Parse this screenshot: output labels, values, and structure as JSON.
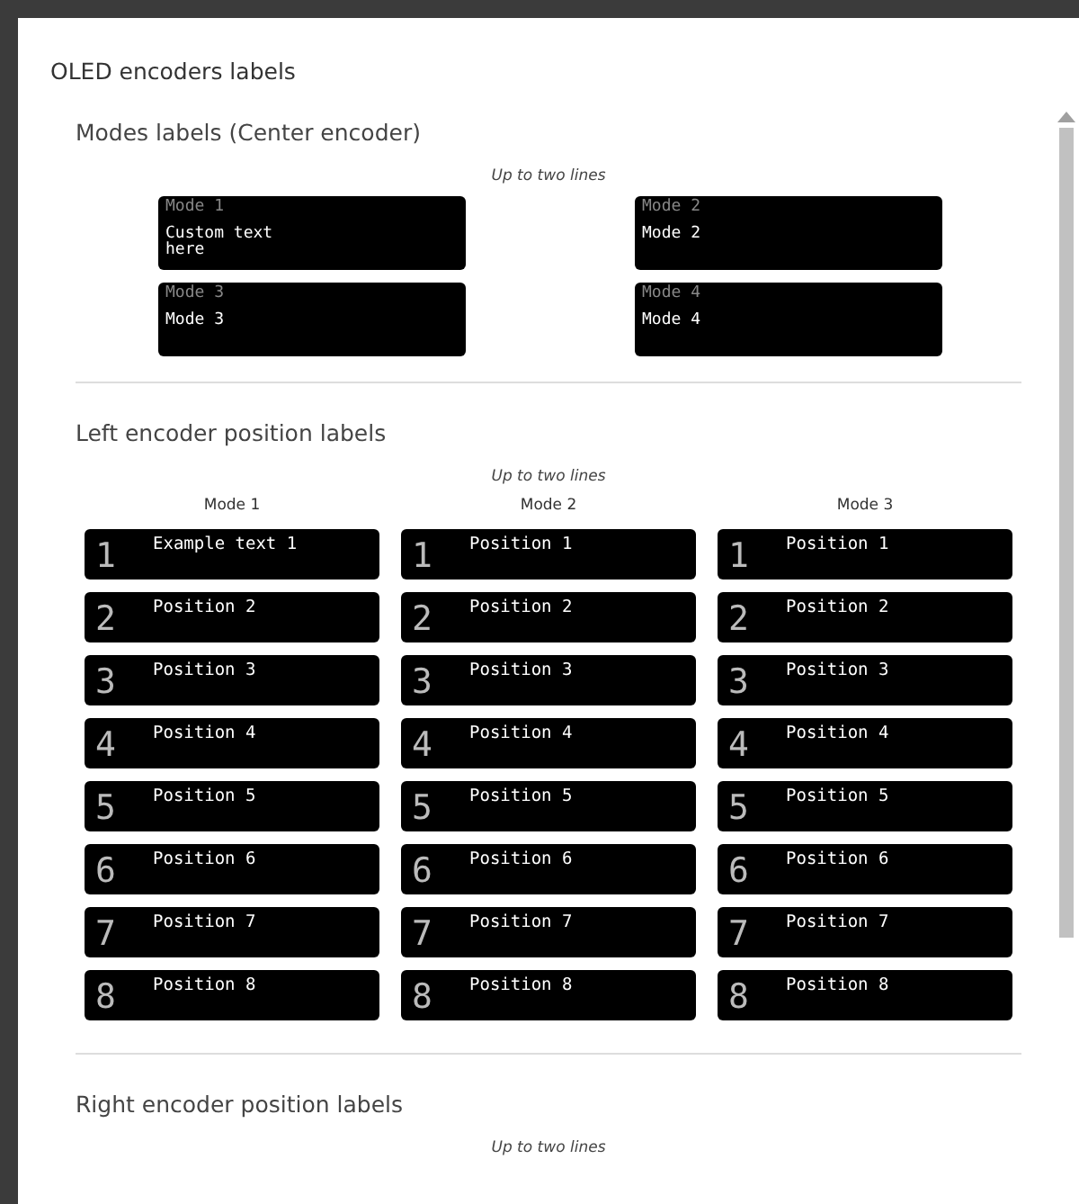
{
  "dialog": {
    "title": "OLED encoders labels"
  },
  "modes_section": {
    "heading": "Modes labels (Center encoder)",
    "hint": "Up to two lines",
    "modes": [
      {
        "label": "Mode 1",
        "value": "Custom text\nhere"
      },
      {
        "label": "Mode 2",
        "value": "Mode 2"
      },
      {
        "label": "Mode 3",
        "value": "Mode 3"
      },
      {
        "label": "Mode 4",
        "value": "Mode 4"
      }
    ]
  },
  "left_section": {
    "heading": "Left encoder position labels",
    "hint": "Up to two lines",
    "columns": [
      {
        "mode": "Mode 1",
        "positions": [
          {
            "number": "1",
            "text": "Example text 1"
          },
          {
            "number": "2",
            "text": "Position 2"
          },
          {
            "number": "3",
            "text": "Position 3"
          },
          {
            "number": "4",
            "text": "Position 4"
          },
          {
            "number": "5",
            "text": "Position 5"
          },
          {
            "number": "6",
            "text": "Position 6"
          },
          {
            "number": "7",
            "text": "Position 7"
          },
          {
            "number": "8",
            "text": "Position 8"
          }
        ]
      },
      {
        "mode": "Mode 2",
        "positions": [
          {
            "number": "1",
            "text": "Position 1"
          },
          {
            "number": "2",
            "text": "Position 2"
          },
          {
            "number": "3",
            "text": "Position 3"
          },
          {
            "number": "4",
            "text": "Position 4"
          },
          {
            "number": "5",
            "text": "Position 5"
          },
          {
            "number": "6",
            "text": "Position 6"
          },
          {
            "number": "7",
            "text": "Position 7"
          },
          {
            "number": "8",
            "text": "Position 8"
          }
        ]
      },
      {
        "mode": "Mode 3",
        "positions": [
          {
            "number": "1",
            "text": "Position 1"
          },
          {
            "number": "2",
            "text": "Position 2"
          },
          {
            "number": "3",
            "text": "Position 3"
          },
          {
            "number": "4",
            "text": "Position 4"
          },
          {
            "number": "5",
            "text": "Position 5"
          },
          {
            "number": "6",
            "text": "Position 6"
          },
          {
            "number": "7",
            "text": "Position 7"
          },
          {
            "number": "8",
            "text": "Position 8"
          }
        ]
      }
    ]
  },
  "right_section": {
    "heading": "Right encoder position labels",
    "hint": "Up to two lines"
  }
}
